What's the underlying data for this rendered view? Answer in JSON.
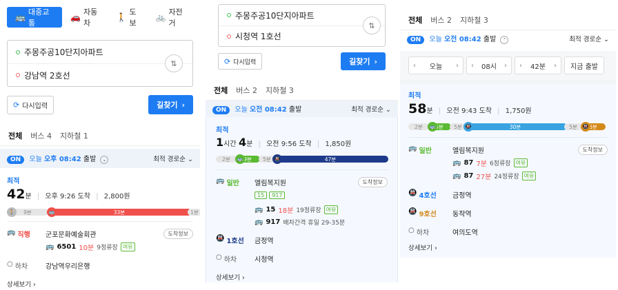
{
  "p1": {
    "modes": [
      {
        "icon": "bus-icon",
        "glyph": "🚌",
        "label": "대중교통"
      },
      {
        "icon": "car-icon",
        "glyph": "🚗",
        "label": "자동차"
      },
      {
        "icon": "walk-icon",
        "glyph": "🚶",
        "label": "도보"
      },
      {
        "icon": "bike-icon",
        "glyph": "🚲",
        "label": "자전거"
      }
    ],
    "origin": "주몽주공10단지아파트",
    "destination": "강남역 2호선",
    "swap_glyph": "⇅",
    "reset_label": "다시입력",
    "search_label": "길찾기",
    "tabs": [
      "전체",
      "버스 4",
      "지하철 1"
    ],
    "on": "ON",
    "today": "오늘",
    "depart_time": "오후 08:42",
    "depart_suffix": "출발",
    "sort": "최적 경로순",
    "best": "최적",
    "duration_num": "42",
    "duration_unit": "분",
    "arrival": "오후 9:26 도착",
    "fare": "2,800원",
    "bar": {
      "walk1": "9분",
      "bus": "33분",
      "walk2": "1분"
    },
    "step1_label": "직행",
    "step1_stop": "군포문화예술회관",
    "arrival_info_label": "도착정보",
    "bus_num": "6501",
    "bus_min": "10분",
    "bus_info": "9정류장",
    "yeoyu": "여유",
    "alight_label": "하차",
    "alight_stop": "강남역우리은행",
    "more": "상세보기"
  },
  "p2": {
    "origin": "주몽주공10단지아파트",
    "destination": "시청역 1호선",
    "swap_glyph": "⇅",
    "reset_label": "다시입력",
    "search_label": "길찾기",
    "tabs": [
      "전체",
      "버스 2",
      "지하철 3"
    ],
    "on": "ON",
    "today": "오늘",
    "depart_time": "오전 08:42",
    "depart_suffix": "출발",
    "sort": "최적 경로순",
    "best": "최적",
    "dur_h": "1",
    "dur_h_unit": "시간",
    "dur_m": "4",
    "dur_m_unit": "분",
    "arrival": "오전 9:56 도착",
    "fare": "1,850원",
    "bar": {
      "walk1": "2분",
      "bus": "9분",
      "walk2": "5분",
      "subway": "47분"
    },
    "step1_label": "일반",
    "step1_stop": "엘림복지원",
    "arrival_info_label": "도착정보",
    "chips": [
      "15",
      "917"
    ],
    "bus1_num": "15",
    "bus1_min": "18분",
    "bus1_info": "19정류장",
    "yeoyu": "여유",
    "bus2_num": "917",
    "bus2_info": "배차간격 휴일 29-35분",
    "step2_label": "1호선",
    "step2_stop": "금정역",
    "alight_label": "하차",
    "alight_stop": "시청역",
    "more": "상세보기"
  },
  "p3": {
    "tabs": [
      "전체",
      "버스 2",
      "지하철 3"
    ],
    "on": "ON",
    "today": "오늘",
    "depart_time": "오전 08:42",
    "depart_suffix": "출발",
    "sort": "최적 경로순",
    "picker": {
      "day": "오늘",
      "hour": "08시",
      "minute": "42분",
      "now": "지금 출발"
    },
    "best": "최적",
    "duration_num": "58",
    "duration_unit": "분",
    "arrival": "오전 9:43 도착",
    "fare": "1,750원",
    "bar": {
      "walk1": "2분",
      "bus": "5분",
      "walk2": "5분",
      "subway": "30분",
      "walk3": "5분",
      "subway2": "6분"
    },
    "step1_label": "일반",
    "step1_stop": "엘림복지원",
    "arrival_info_label": "도착정보",
    "bus1_num": "87",
    "bus1_min": "7분",
    "bus1_info": "6정류장",
    "bus2_num": "87",
    "bus2_min": "27분",
    "bus2_info": "24정류장",
    "yeoyu": "여유",
    "step2_label": "4호선",
    "step2_stop": "금정역",
    "step3_label": "9호선",
    "step3_stop": "동작역",
    "alight_label": "하차",
    "alight_stop": "여의도역",
    "more": "상세보기"
  },
  "colors": {
    "primary": "#1e7cf2",
    "bus_red": "#f0504c",
    "line1_navy": "#1e3a8a",
    "bus_green": "#5aba32",
    "line4_sky": "#38a3e0",
    "line9_gold": "#d48a1b"
  }
}
